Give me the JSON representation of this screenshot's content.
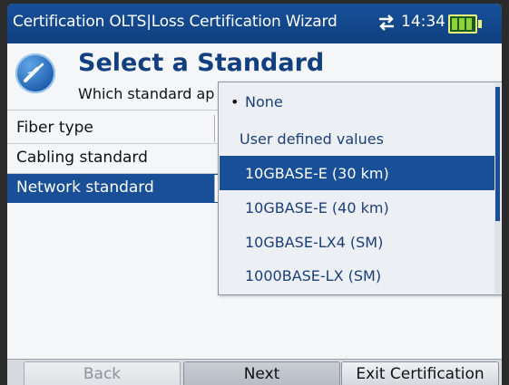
{
  "titlebar": {
    "title": "Certification OLTS|Loss Certification Wizard",
    "time": "14:34",
    "colors": {
      "bar": "#17509a",
      "battery": "#8fd23a"
    }
  },
  "header": {
    "title": "Select a Standard",
    "subtitle": "Which standard ap"
  },
  "fields": [
    {
      "label": "Fiber type"
    },
    {
      "label": "Cabling standard"
    },
    {
      "label": "Network standard",
      "selected": true
    }
  ],
  "dropdown": {
    "options": [
      {
        "label": "None",
        "checked": true
      },
      {
        "label": "User defined values"
      },
      {
        "label": "10GBASE-E (30 km)",
        "highlighted": true
      },
      {
        "label": "10GBASE-E (40 km)"
      },
      {
        "label": "10GBASE-LX4 (SM)"
      },
      {
        "label": "1000BASE-LX (SM)"
      }
    ]
  },
  "footer": {
    "back": "Back",
    "next": "Next",
    "exit": "Exit Certification"
  },
  "icons": {
    "transfer": "transfer-arrows-icon",
    "battery": "battery-icon",
    "logo": "fiber-probe-logo-icon"
  }
}
